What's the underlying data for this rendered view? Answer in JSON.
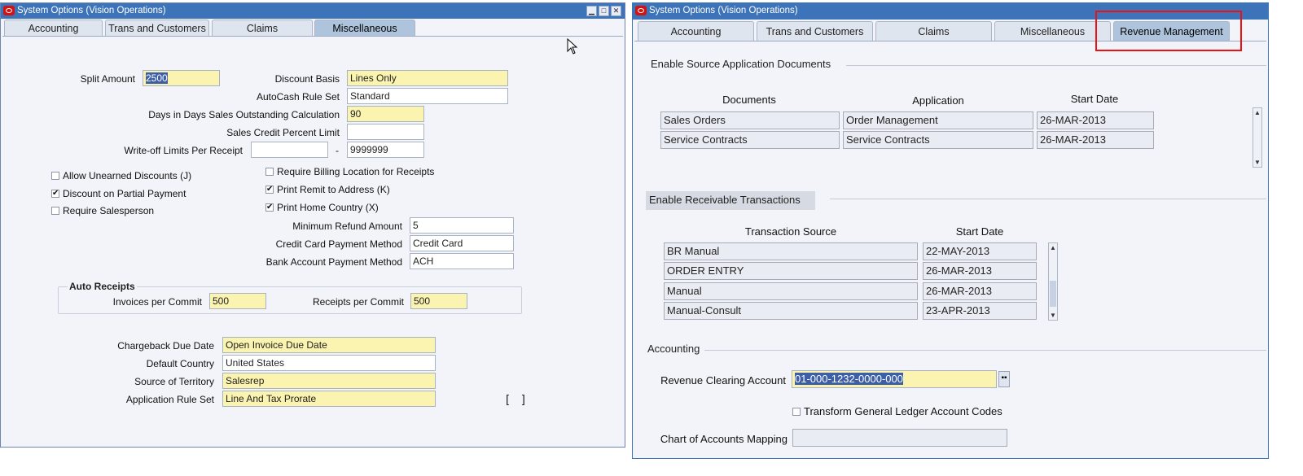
{
  "left": {
    "title": "System Options (Vision Operations)",
    "tabs": [
      "Accounting",
      "Trans and Customers",
      "Claims",
      "Miscellaneous"
    ],
    "fields": {
      "split_amount": {
        "label": "Split Amount",
        "value": "2500"
      },
      "discount_basis": {
        "label": "Discount Basis",
        "value": "Lines Only"
      },
      "autocash_rule_set": {
        "label": "AutoCash Rule Set",
        "value": "Standard"
      },
      "days_dso": {
        "label": "Days in Days Sales Outstanding Calculation",
        "value": "90"
      },
      "sales_credit_limit": {
        "label": "Sales Credit Percent Limit",
        "value": ""
      },
      "writeoff_limits": {
        "label": "Write-off Limits Per Receipt",
        "from": "",
        "separator": "-",
        "to": "9999999"
      },
      "min_refund": {
        "label": "Minimum Refund Amount",
        "value": "5"
      },
      "cc_payment_method": {
        "label": "Credit Card Payment Method",
        "value": "Credit Card"
      },
      "bank_payment_method": {
        "label": "Bank Account Payment Method",
        "value": "ACH"
      },
      "chargeback_due_date": {
        "label": "Chargeback Due Date",
        "value": "Open Invoice Due Date"
      },
      "default_country": {
        "label": "Default Country",
        "value": "United States"
      },
      "source_of_territory": {
        "label": "Source of Territory",
        "value": "Salesrep"
      },
      "application_rule_set": {
        "label": "Application Rule Set",
        "value": "Line And Tax Prorate"
      }
    },
    "checkboxes": {
      "allow_unearned": {
        "label": "Allow Unearned Discounts (J)",
        "checked": false
      },
      "discount_partial": {
        "label": "Discount on Partial Payment",
        "checked": true
      },
      "require_salesperson": {
        "label": "Require Salesperson",
        "checked": false
      },
      "require_billing": {
        "label": "Require Billing Location for Receipts",
        "checked": false
      },
      "print_remit": {
        "label": "Print Remit to Address (K)",
        "checked": true
      },
      "print_home_country": {
        "label": "Print Home Country (X)",
        "checked": true
      }
    },
    "auto_receipts": {
      "title": "Auto Receipts",
      "invoices_label": "Invoices per Commit",
      "invoices_value": "500",
      "receipts_label": "Receipts per Commit",
      "receipts_value": "500"
    },
    "desc_flex": "[ ]"
  },
  "right": {
    "title": "System Options (Vision Operations)",
    "tabs": [
      "Accounting",
      "Trans and Customers",
      "Claims",
      "Miscellaneous",
      "Revenue Management"
    ],
    "source_docs": {
      "title": "Enable Source Application Documents",
      "headers": [
        "Documents",
        "Application",
        "Start Date"
      ],
      "rows": [
        [
          "Sales Orders",
          "Order Management",
          "26-MAR-2013"
        ],
        [
          "Service Contracts",
          "Service Contracts",
          "26-MAR-2013"
        ]
      ]
    },
    "receivable": {
      "title": "Enable Receivable Transactions",
      "headers": [
        "Transaction Source",
        "Start Date"
      ],
      "rows": [
        [
          "BR Manual",
          "22-MAY-2013"
        ],
        [
          "ORDER ENTRY",
          "26-MAR-2013"
        ],
        [
          "Manual",
          "26-MAR-2013"
        ],
        [
          "Manual-Consult",
          "23-APR-2013"
        ]
      ]
    },
    "accounting": {
      "title": "Accounting",
      "revenue_clearing_label": "Revenue Clearing Account",
      "revenue_clearing_value": "01-000-1232-0000-000",
      "transform_label": "Transform General Ledger Account Codes",
      "transform_checked": false,
      "coa_mapping_label": "Chart of Accounts Mapping",
      "coa_mapping_value": ""
    }
  },
  "colors": {
    "title_bar": "#3d73b8",
    "required_field": "#fbf3b0",
    "highlight": "#e11111"
  }
}
